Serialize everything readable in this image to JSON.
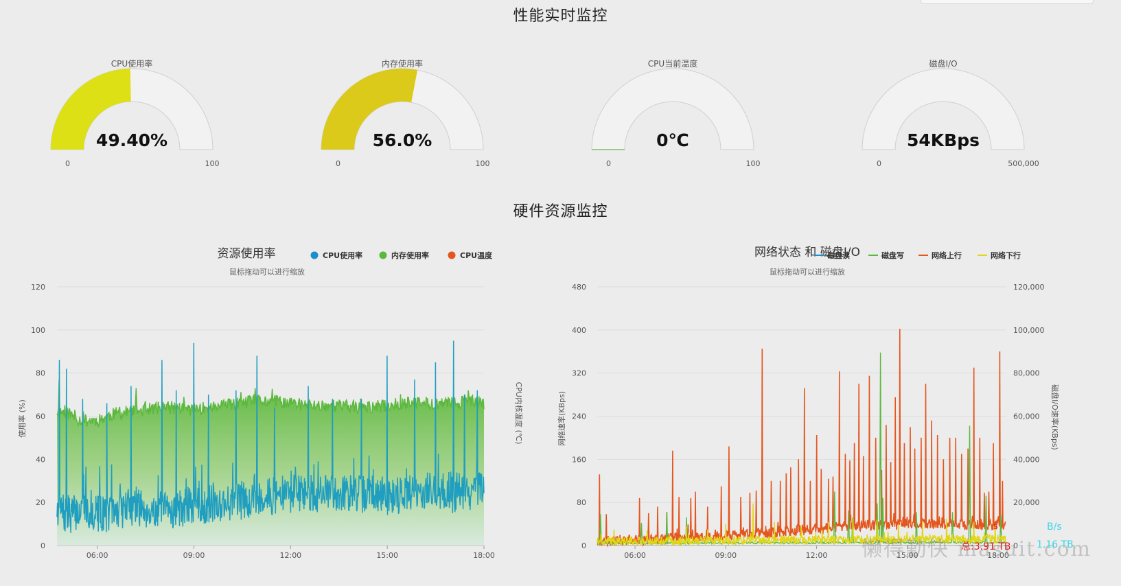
{
  "sections": {
    "realtime_title": "性能实时监控",
    "hardware_title": "硬件资源监控"
  },
  "gauges": [
    {
      "title": "CPU使用率",
      "display": "49.40%",
      "value": 49.4,
      "min_label": "0",
      "max_label": "100",
      "max": 100,
      "color": "#dce014"
    },
    {
      "title": "内存使用率",
      "display": "56.0%",
      "value": 56.0,
      "min_label": "0",
      "max_label": "100",
      "max": 100,
      "color": "#dcca1b"
    },
    {
      "title": "CPU当前温度",
      "display": "0℃",
      "value": 0,
      "min_label": "0",
      "max_label": "100",
      "max": 100,
      "color": "#7cc06b"
    },
    {
      "title": "磁盘I/O",
      "display": "54KBps",
      "value": 54,
      "min_label": "0",
      "max_label": "500,000",
      "max": 500000,
      "color": "#7cc06b"
    }
  ],
  "chart_data": [
    {
      "type": "area",
      "title": "资源使用率",
      "subtitle": "鼠标拖动可以进行缩放",
      "ylabel": "使用率 (%)",
      "y2label": "CPU内核温度 (℃)",
      "ylim": [
        0,
        120
      ],
      "yticks": [
        "0",
        "20",
        "40",
        "60",
        "80",
        "100",
        "120"
      ],
      "x_range_hours": [
        4.75,
        18.0
      ],
      "xticks": [
        {
          "h": 6,
          "label": "06:00"
        },
        {
          "h": 9,
          "label": "09:00"
        },
        {
          "h": 12,
          "label": "12:00"
        },
        {
          "h": 15,
          "label": "15:00"
        },
        {
          "h": 18,
          "label": "18:00"
        }
      ],
      "legend_position": "top",
      "series": [
        {
          "name": "CPU使用率",
          "color": "#1b8fcd",
          "shape": "dot",
          "anchors": [
            [
              4.75,
              18
            ],
            [
              5.0,
              14
            ],
            [
              5.5,
              16
            ],
            [
              6.0,
              15
            ],
            [
              6.5,
              15
            ],
            [
              7.0,
              18
            ],
            [
              7.5,
              17
            ],
            [
              8.0,
              16
            ],
            [
              8.5,
              17
            ],
            [
              9.0,
              18
            ],
            [
              9.5,
              19
            ],
            [
              10.0,
              20
            ],
            [
              10.5,
              21
            ],
            [
              11.0,
              22
            ],
            [
              11.5,
              23
            ],
            [
              12.0,
              24
            ],
            [
              12.5,
              24
            ],
            [
              13.0,
              24
            ],
            [
              13.5,
              25
            ],
            [
              14.0,
              24
            ],
            [
              14.5,
              24
            ],
            [
              15.0,
              23
            ],
            [
              15.5,
              24
            ],
            [
              16.0,
              25
            ],
            [
              16.5,
              25
            ],
            [
              17.0,
              24
            ],
            [
              17.5,
              25
            ],
            [
              18.0,
              25
            ]
          ],
          "spikes": [
            [
              4.82,
              86
            ],
            [
              5.05,
              82
            ],
            [
              5.55,
              68
            ],
            [
              6.3,
              66
            ],
            [
              7.05,
              74
            ],
            [
              8.0,
              86
            ],
            [
              8.45,
              72
            ],
            [
              9.0,
              94
            ],
            [
              9.45,
              70
            ],
            [
              10.3,
              72
            ],
            [
              10.95,
              88
            ],
            [
              11.5,
              64
            ],
            [
              12.55,
              74
            ],
            [
              13.3,
              68
            ],
            [
              14.2,
              68
            ],
            [
              15.0,
              88
            ],
            [
              15.85,
              77
            ],
            [
              16.5,
              85
            ],
            [
              17.05,
              95
            ],
            [
              17.4,
              70
            ],
            [
              17.8,
              72
            ]
          ]
        },
        {
          "name": "内存使用率",
          "color": "#5cb83d",
          "shape": "dot",
          "anchors": [
            [
              4.75,
              62
            ],
            [
              5.0,
              62
            ],
            [
              5.5,
              58
            ],
            [
              6.0,
              58
            ],
            [
              6.5,
              61
            ],
            [
              7.0,
              62
            ],
            [
              7.5,
              63
            ],
            [
              8.0,
              64
            ],
            [
              8.5,
              64
            ],
            [
              9.0,
              63
            ],
            [
              9.5,
              64
            ],
            [
              10.0,
              65
            ],
            [
              10.5,
              66
            ],
            [
              11.0,
              67
            ],
            [
              11.5,
              67
            ],
            [
              12.0,
              66
            ],
            [
              12.5,
              65
            ],
            [
              13.0,
              65
            ],
            [
              13.5,
              65
            ],
            [
              14.0,
              64
            ],
            [
              14.5,
              64
            ],
            [
              15.0,
              65
            ],
            [
              15.5,
              66
            ],
            [
              16.0,
              66
            ],
            [
              16.5,
              66
            ],
            [
              17.0,
              66
            ],
            [
              17.5,
              67
            ],
            [
              18.0,
              66
            ]
          ],
          "spikes": [
            [
              4.82,
              77
            ],
            [
              7.2,
              73
            ],
            [
              10.9,
              73
            ],
            [
              13.4,
              62
            ],
            [
              16.6,
              67
            ]
          ]
        },
        {
          "name": "CPU温度",
          "color": "#e4561e",
          "shape": "dot",
          "anchors": [],
          "spikes": []
        }
      ]
    },
    {
      "type": "line",
      "title": "网络状态 和 磁盘I/O",
      "subtitle": "鼠标拖动可以进行缩放",
      "ylabel": "网络速率(KBps)",
      "y2label": "磁盘I/O速率(KBps)",
      "ylim": [
        0,
        480
      ],
      "y2lim": [
        0,
        120000
      ],
      "yticks": [
        "0",
        "80",
        "160",
        "240",
        "320",
        "400",
        "480"
      ],
      "y2ticks": [
        "0",
        "20,000",
        "40,000",
        "60,000",
        "80,000",
        "100,000",
        "120,000"
      ],
      "x_range_hours": [
        4.75,
        18.25
      ],
      "xticks": [
        {
          "h": 6,
          "label": "06:00"
        },
        {
          "h": 9,
          "label": "09:00"
        },
        {
          "h": 12,
          "label": "12:00"
        },
        {
          "h": 15,
          "label": "15:00"
        },
        {
          "h": 18,
          "label": "18:00"
        }
      ],
      "legend_position": "top",
      "series": [
        {
          "name": "磁盘读",
          "color": "#1b8fcd",
          "shape": "line",
          "anchors": [],
          "spikes": []
        },
        {
          "name": "磁盘写",
          "color": "#5cb83d",
          "shape": "line",
          "anchors": [
            [
              4.75,
              4
            ],
            [
              18.25,
              6
            ]
          ],
          "spikes": [
            [
              4.85,
              58
            ],
            [
              6.2,
              42
            ],
            [
              7.05,
              62
            ],
            [
              7.7,
              52
            ],
            [
              12.6,
              100
            ],
            [
              13.2,
              52
            ],
            [
              14.0,
              78
            ],
            [
              14.2,
              88
            ],
            [
              15.3,
              62
            ],
            [
              16.5,
              62
            ],
            [
              17.6,
              92
            ],
            [
              18.1,
              56
            ],
            [
              14.1,
              358
            ],
            [
              17.05,
              222
            ],
            [
              13.05,
              65
            ]
          ]
        },
        {
          "name": "网络上行",
          "color": "#e4561e",
          "shape": "line",
          "anchors": [
            [
              4.75,
              8
            ],
            [
              7.0,
              12
            ],
            [
              9.0,
              18
            ],
            [
              11.0,
              26
            ],
            [
              13.0,
              36
            ],
            [
              15.0,
              40
            ],
            [
              18.25,
              38
            ]
          ],
          "spikes": [
            [
              4.82,
              132
            ],
            [
              5.05,
              58
            ],
            [
              6.15,
              88
            ],
            [
              6.45,
              60
            ],
            [
              6.75,
              72
            ],
            [
              7.05,
              62
            ],
            [
              7.25,
              176
            ],
            [
              7.45,
              90
            ],
            [
              7.85,
              88
            ],
            [
              8.0,
              100
            ],
            [
              8.4,
              72
            ],
            [
              8.85,
              110
            ],
            [
              9.1,
              184
            ],
            [
              9.5,
              90
            ],
            [
              9.8,
              98
            ],
            [
              10.0,
              102
            ],
            [
              10.2,
              365
            ],
            [
              10.5,
              120
            ],
            [
              10.8,
              120
            ],
            [
              11.0,
              134
            ],
            [
              11.15,
              145
            ],
            [
              11.4,
              160
            ],
            [
              11.6,
              292
            ],
            [
              11.8,
              120
            ],
            [
              12.0,
              205
            ],
            [
              12.15,
              142
            ],
            [
              12.4,
              124
            ],
            [
              12.55,
              128
            ],
            [
              12.75,
              323
            ],
            [
              12.95,
              170
            ],
            [
              13.1,
              158
            ],
            [
              13.25,
              190
            ],
            [
              13.4,
              300
            ],
            [
              13.55,
              166
            ],
            [
              13.75,
              315
            ],
            [
              13.95,
              200
            ],
            [
              14.15,
              140
            ],
            [
              14.3,
              224
            ],
            [
              14.45,
              155
            ],
            [
              14.6,
              275
            ],
            [
              14.75,
              402
            ],
            [
              14.9,
              190
            ],
            [
              15.1,
              220
            ],
            [
              15.25,
              180
            ],
            [
              15.45,
              200
            ],
            [
              15.6,
              300
            ],
            [
              15.8,
              232
            ],
            [
              16.0,
              205
            ],
            [
              16.2,
              160
            ],
            [
              16.4,
              200
            ],
            [
              16.6,
              200
            ],
            [
              16.8,
              170
            ],
            [
              17.0,
              180
            ],
            [
              17.2,
              330
            ],
            [
              17.4,
              200
            ],
            [
              17.55,
              98
            ],
            [
              17.7,
              100
            ],
            [
              17.85,
              190
            ],
            [
              18.05,
              360
            ],
            [
              18.15,
              120
            ]
          ]
        },
        {
          "name": "网络下行",
          "color": "#e0d616",
          "shape": "line",
          "anchors": [
            [
              4.75,
              8
            ],
            [
              18.25,
              12
            ]
          ],
          "spikes": [
            [
              5.3,
              30
            ],
            [
              6.4,
              28
            ],
            [
              7.7,
              36
            ],
            [
              8.4,
              30
            ],
            [
              9.0,
              40
            ],
            [
              9.9,
              78
            ],
            [
              10.6,
              44
            ],
            [
              11.5,
              36
            ],
            [
              12.4,
              44
            ],
            [
              13.2,
              52
            ],
            [
              14.0,
              48
            ],
            [
              14.7,
              40
            ],
            [
              15.5,
              46
            ],
            [
              16.3,
              50
            ],
            [
              17.2,
              44
            ],
            [
              17.9,
              40
            ]
          ]
        }
      ]
    }
  ],
  "watermark": "懒得勤快 masuit.com",
  "corner": {
    "rate_partial": "B/s",
    "total_partial": "总:3.91 TB",
    "total2": "1.16 TB",
    "s_letter": "s"
  }
}
